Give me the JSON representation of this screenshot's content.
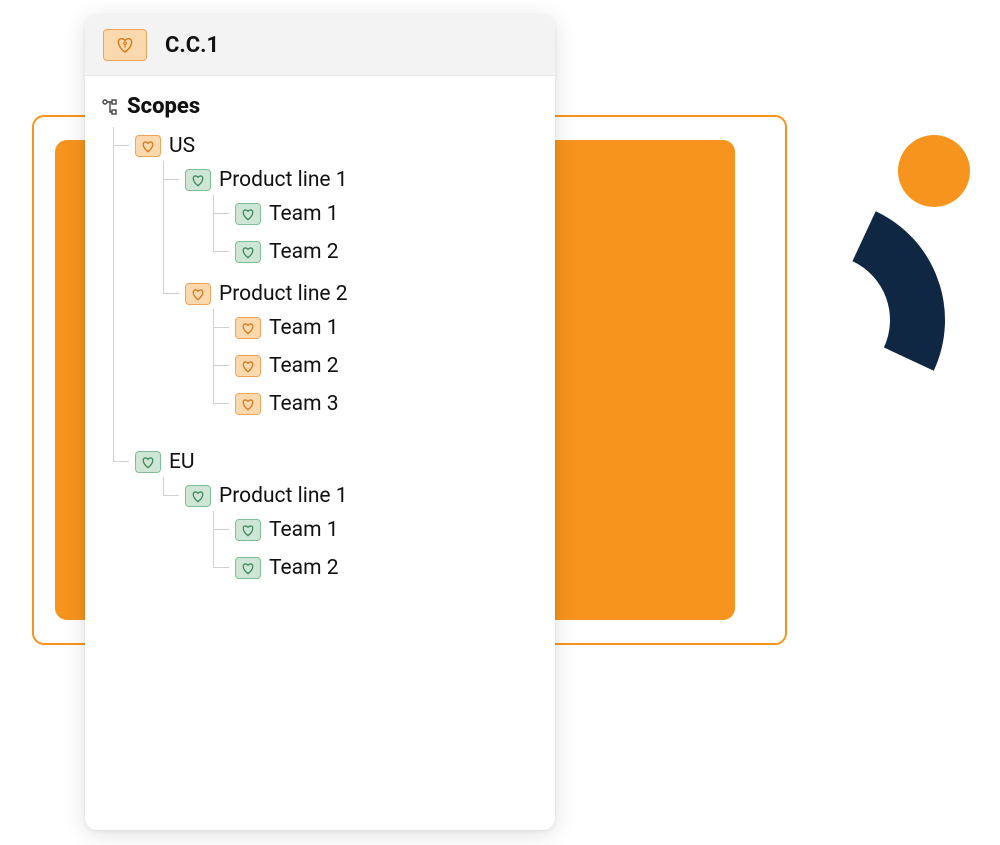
{
  "colors": {
    "orange": "#f7941d",
    "navy": "#0f2743",
    "badge_orange_bg": "#fbd9ae",
    "badge_orange_border": "#f2a45a",
    "badge_green_bg": "#cfe6d6",
    "badge_green_border": "#7fbf96"
  },
  "header": {
    "title": "C.C.1",
    "icon": "heart-key-icon",
    "icon_color": "orange"
  },
  "section": {
    "title": "Scopes",
    "icon": "hierarchy-icon"
  },
  "tree": {
    "regions": [
      {
        "label": "US",
        "icon_color": "orange",
        "product_lines": [
          {
            "label": "Product line 1",
            "icon_color": "green",
            "teams": [
              {
                "label": "Team 1",
                "icon_color": "green"
              },
              {
                "label": "Team 2",
                "icon_color": "green"
              }
            ]
          },
          {
            "label": "Product line 2",
            "icon_color": "orange",
            "teams": [
              {
                "label": "Team 1",
                "icon_color": "orange"
              },
              {
                "label": "Team 2",
                "icon_color": "orange"
              },
              {
                "label": "Team 3",
                "icon_color": "orange"
              }
            ]
          }
        ]
      },
      {
        "label": "EU",
        "icon_color": "green",
        "product_lines": [
          {
            "label": "Product line 1",
            "icon_color": "green",
            "teams": [
              {
                "label": "Team 1",
                "icon_color": "green"
              },
              {
                "label": "Team 2",
                "icon_color": "green"
              }
            ]
          }
        ]
      }
    ]
  }
}
